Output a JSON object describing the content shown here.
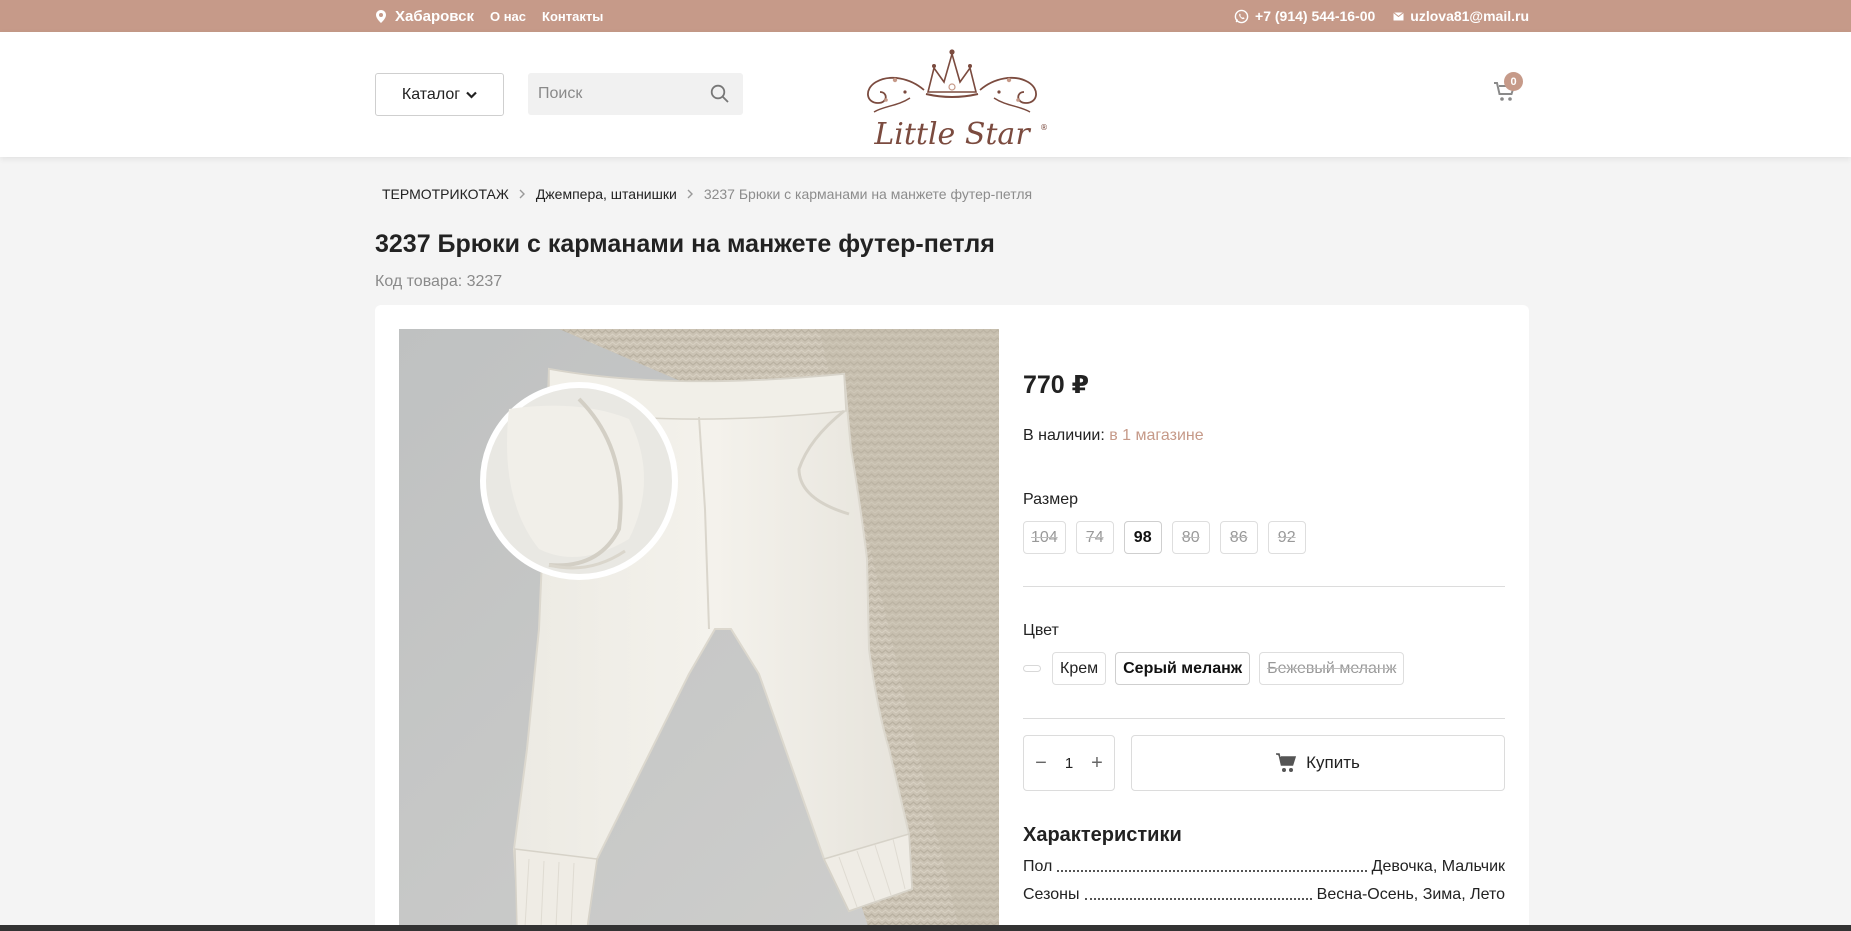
{
  "topbar": {
    "city": "Хабаровск",
    "about": "О нас",
    "contacts": "Контакты",
    "phone": "+7 (914) 544-16-00",
    "email": "uzlova81@mail.ru"
  },
  "header": {
    "catalog_label": "Каталог",
    "search_placeholder": "Поиск",
    "logo_text": "Little Star",
    "cart_count": "0"
  },
  "breadcrumb": {
    "items": [
      "ТЕРМОТРИКОТАЖ",
      "Джемпера, штанишки"
    ],
    "current": "3237 Брюки с карманами на манжете футер-петля"
  },
  "product": {
    "title": "3237 Брюки с карманами на манжете футер-петля",
    "sku": "Код товара: 3237",
    "price": "770 ₽",
    "stock_label": "В наличии:",
    "stock_link": "в 1 магазине",
    "size_label": "Размер",
    "sizes": [
      "104",
      "74",
      "98",
      "80",
      "86",
      "92"
    ],
    "selected_size": "98",
    "color_label": "Цвет",
    "colors": [
      "Крем",
      "Серый меланж",
      "Бежевый меланж"
    ],
    "selected_color": "Серый меланж",
    "quantity": "1",
    "buy_label": "Купить",
    "characteristics_title": "Характеристики",
    "characteristics": [
      {
        "name": "Пол",
        "value": "Девочка, Мальчик"
      },
      {
        "name": "Сезоны",
        "value": "Весна-Осень, Зима, Лето"
      }
    ]
  },
  "colors": {
    "accent": "#c69a89",
    "background": "#f4f4f4"
  }
}
